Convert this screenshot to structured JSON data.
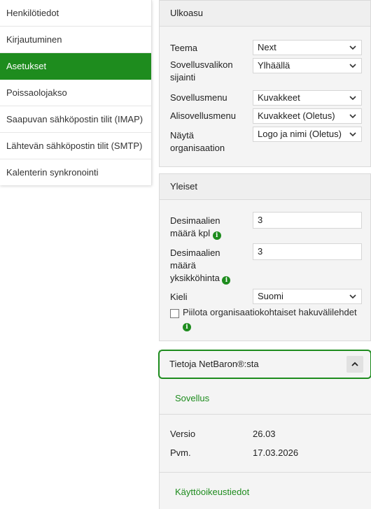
{
  "nav": {
    "items": [
      {
        "label": "Henkilötiedot",
        "active": false
      },
      {
        "label": "Kirjautuminen",
        "active": false
      },
      {
        "label": "Asetukset",
        "active": true
      },
      {
        "label": "Poissaolojakso",
        "active": false
      },
      {
        "label": "Saapuvan sähköpostin tilit (IMAP)",
        "active": false
      },
      {
        "label": "Lähtevän sähköpostin tilit (SMTP)",
        "active": false
      },
      {
        "label": "Kalenterin synkronointi",
        "active": false
      }
    ]
  },
  "appearance": {
    "title": "Ulkoasu",
    "theme_label": "Teema",
    "theme_value": "Next",
    "appmenu_position_label": "Sovellusvalikon sijainti",
    "appmenu_position_value": "Ylhäällä",
    "appmenu_label": "Sovellusmenu",
    "appmenu_value": "Kuvakkeet",
    "subappmenu_label": "Alisovellusmenu",
    "subappmenu_value": "Kuvakkeet (Oletus)",
    "show_org_label": "Näytä organisaation",
    "show_org_value": "Logo ja nimi (Oletus)"
  },
  "general": {
    "title": "Yleiset",
    "decimals_qty_label": "Desimaalien määrä kpl",
    "decimals_qty_value": "3",
    "decimals_unit_label": "Desimaalien määrä yksikköhinta",
    "decimals_unit_value": "3",
    "language_label": "Kieli",
    "language_value": "Suomi",
    "hide_tabs_label": "Piilota organisaatiokohtaiset hakuvälilehdet",
    "hide_tabs_checked": false,
    "info_glyph": "i"
  },
  "about": {
    "title": "Tietoja NetBaron®:sta",
    "app_link": "Sovellus",
    "version_label": "Versio",
    "version_value": "26.03",
    "date_label": "Pvm.",
    "date_value": "17.03.2026",
    "license_link": "Käyttöoikeustiedot"
  },
  "colors": {
    "accent": "#1e8c1e",
    "panel_bg": "#f4f4f4",
    "border": "#dadada"
  },
  "icons": {
    "dropdown": "chevron-down-icon",
    "collapse": "chevron-up-icon",
    "info": "info-icon"
  }
}
